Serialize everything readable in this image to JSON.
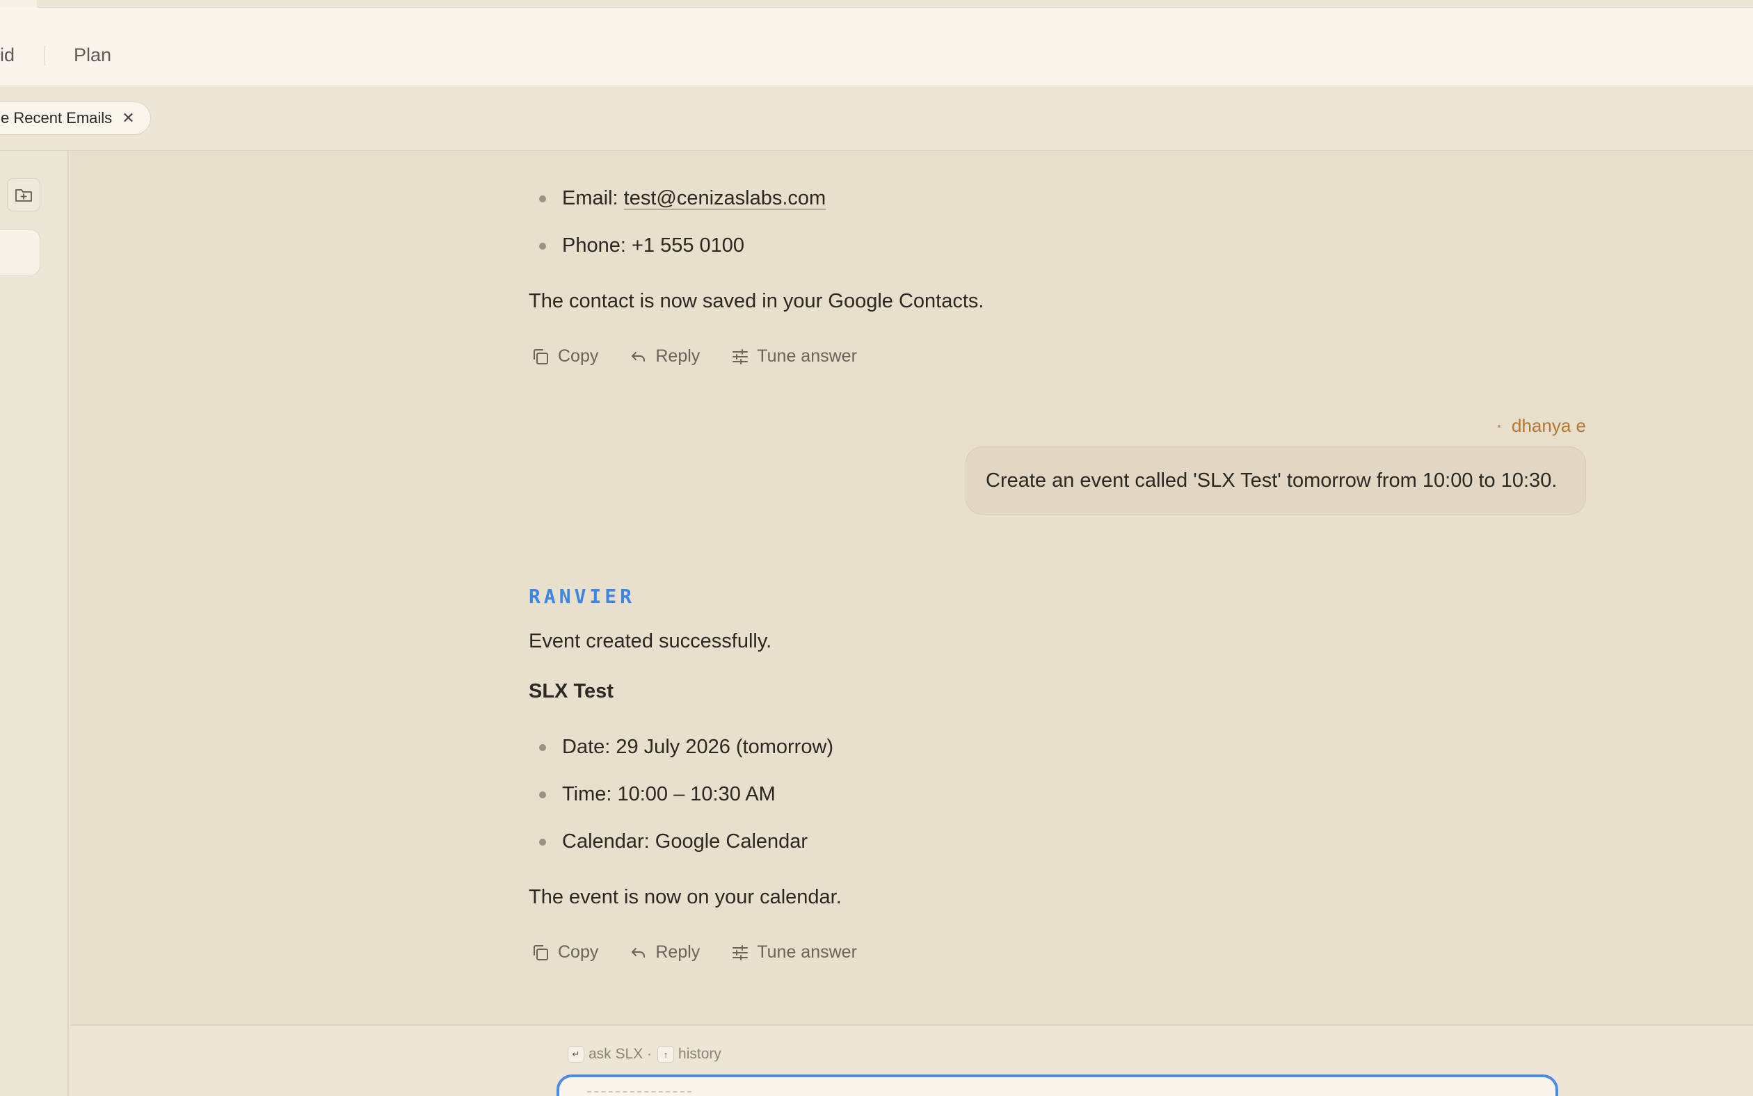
{
  "header": {
    "items": [
      "id",
      "Plan"
    ]
  },
  "tabs": {
    "active_chip": "e Recent Emails",
    "close_glyph": "✕"
  },
  "chat": {
    "contact_bullets": [
      {
        "label": "Email: ",
        "value": "test@cenizaslabs.com"
      },
      {
        "label": "Phone: ",
        "value": "+1 555 0100"
      }
    ],
    "contact_saved": "The contact is now saved in your Google Contacts.",
    "actions": {
      "copy": "Copy",
      "reply": "Reply",
      "tune": "Tune answer"
    },
    "user": {
      "name": "dhanya e",
      "message": "Create an event called 'SLX Test' tomorrow from 10:00 to 10:30."
    },
    "bot": {
      "name": "RANVIER",
      "intro": "Event created successfully.",
      "event_title": "SLX Test",
      "event_bullets": [
        "Date: 29 July 2026 (tomorrow)",
        "Time: 10:00 – 10:30 AM",
        "Calendar: Google Calendar"
      ],
      "outro": "The event is now on your calendar."
    }
  },
  "composer": {
    "hint_enter_key": "↵",
    "hint_enter_label": "ask SLX ·",
    "hint_history_key": "↑",
    "hint_history_label": "history"
  },
  "colors": {
    "accent_blue": "#3c86e4",
    "user_name": "#b57731",
    "chat_bg": "#e8e0cd"
  },
  "icons": [
    "folder-plus-icon",
    "copy-icon",
    "reply-icon",
    "sliders-icon",
    "close-icon"
  ]
}
